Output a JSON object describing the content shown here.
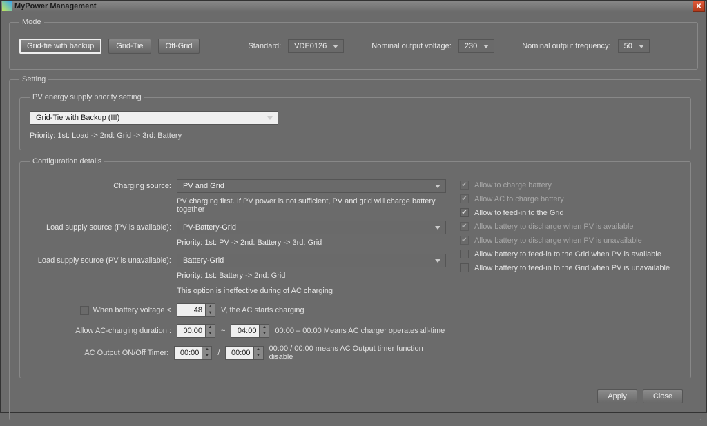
{
  "window": {
    "title": "MyPower Management"
  },
  "mode": {
    "legend": "Mode",
    "buttons": {
      "grid_tie_backup": "Grid-tie with backup",
      "grid_tie": "Grid-Tie",
      "off_grid": "Off-Grid"
    },
    "standard_label": "Standard:",
    "standard_value": "VDE0126",
    "voltage_label": "Nominal output voltage:",
    "voltage_value": "230",
    "frequency_label": "Nominal output frequency:",
    "frequency_value": "50"
  },
  "setting": {
    "legend": "Setting",
    "pv_priority": {
      "legend": "PV energy supply priority setting",
      "selected": "Grid-Tie with Backup (III)",
      "priority_text": "Priority: 1st: Load -> 2nd: Grid -> 3rd: Battery"
    },
    "config": {
      "legend": "Configuration details",
      "charging_source_label": "Charging source:",
      "charging_source_value": "PV and Grid",
      "charging_source_note": "PV charging first. If PV power is not sufficient, PV and grid will charge battery together",
      "load_available_label": "Load supply source (PV is available):",
      "load_available_value": "PV-Battery-Grid",
      "load_available_note": "Priority: 1st: PV -> 2nd: Battery -> 3rd: Grid",
      "load_unavailable_label": "Load supply source (PV is unavailable):",
      "load_unavailable_value": "Battery-Grid",
      "load_unavailable_note1": "Priority: 1st: Battery -> 2nd: Grid",
      "load_unavailable_note2": "This option is ineffective during of AC charging",
      "checks": {
        "allow_charge": "Allow to charge battery",
        "allow_ac_charge": "Allow AC to charge battery",
        "allow_feed_grid": "Allow to feed-in to the Grid",
        "allow_discharge_pv_avail": "Allow battery to discharge when PV is available",
        "allow_discharge_pv_unavail": "Allow battery to discharge when PV is unavailable",
        "allow_feed_pv_avail": "Allow battery to feed-in to the Grid when PV is available",
        "allow_feed_pv_unavail": "Allow battery to feed-in to the Grid when PV is unavailable"
      },
      "bottom": {
        "batt_voltage_prefix": "When battery voltage <",
        "batt_voltage_value": "48",
        "batt_voltage_suffix": "V,    the AC starts charging",
        "ac_charge_label": "Allow AC-charging duration :",
        "ac_charge_from": "00:00",
        "tilde": "~",
        "ac_charge_to": "04:00",
        "ac_charge_note": "00:00 – 00:00 Means AC charger operates all-time",
        "timer_label": "AC Output ON/Off Timer:",
        "timer_on": "00:00",
        "slash": "/",
        "timer_off": "00:00",
        "timer_note": "00:00 / 00:00 means AC Output timer function disable"
      }
    }
  },
  "footer": {
    "apply": "Apply",
    "close": "Close"
  }
}
